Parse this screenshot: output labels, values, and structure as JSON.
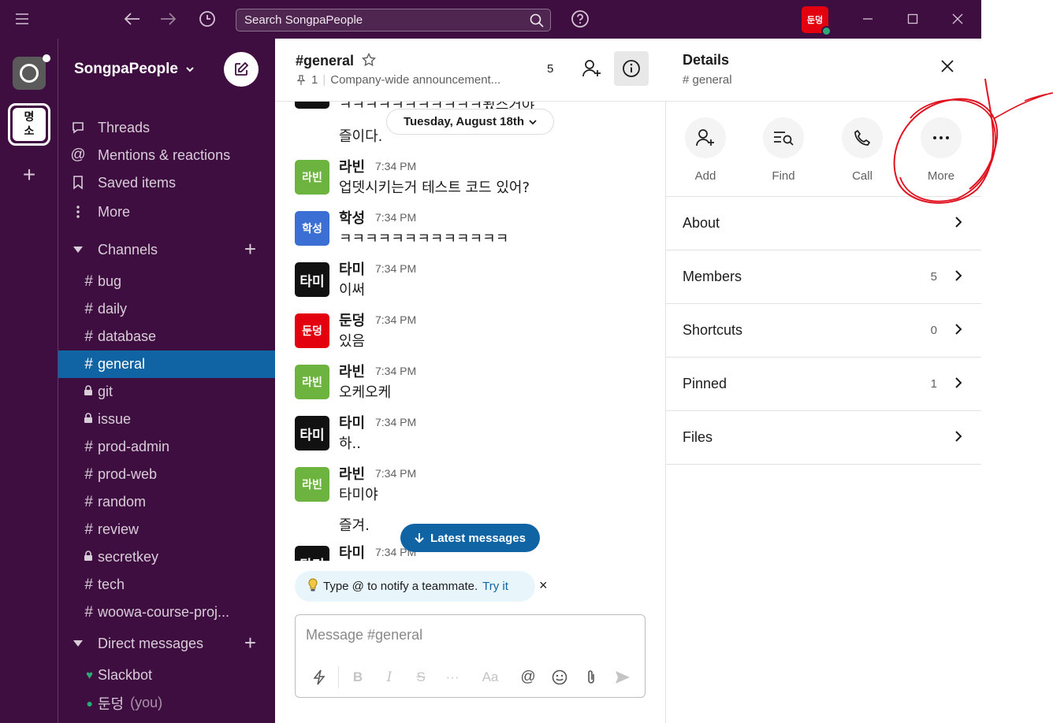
{
  "titlebar": {
    "search_placeholder": "Search SongpaPeople",
    "user_avatar_text": "둔덩"
  },
  "rail": {
    "workspace2_text_top": "명",
    "workspace2_text_bottom": "소"
  },
  "sidebar": {
    "workspace_name": "SongpaPeople",
    "nav": [
      {
        "label": "Threads"
      },
      {
        "label": "Mentions & reactions"
      },
      {
        "label": "Saved items"
      },
      {
        "label": "More"
      }
    ],
    "channels_header": "Channels",
    "channels": [
      {
        "prefix": "#",
        "name": "bug"
      },
      {
        "prefix": "#",
        "name": "daily"
      },
      {
        "prefix": "#",
        "name": "database"
      },
      {
        "prefix": "#",
        "name": "general"
      },
      {
        "prefix": "lock",
        "name": "git"
      },
      {
        "prefix": "lock",
        "name": "issue"
      },
      {
        "prefix": "#",
        "name": "prod-admin"
      },
      {
        "prefix": "#",
        "name": "prod-web"
      },
      {
        "prefix": "#",
        "name": "random"
      },
      {
        "prefix": "#",
        "name": "review"
      },
      {
        "prefix": "lock",
        "name": "secretkey"
      },
      {
        "prefix": "#",
        "name": "tech"
      },
      {
        "prefix": "#",
        "name": "woowa-course-proj..."
      }
    ],
    "dm_header": "Direct messages",
    "dms": [
      {
        "name": "Slackbot",
        "suffix": ""
      },
      {
        "name": "둔덩",
        "suffix": "(you)"
      }
    ]
  },
  "channel": {
    "title": "#general",
    "pinned_count": "1",
    "topic": "Company-wide announcement...",
    "member_count": "5",
    "date_divider": "Tuesday, August 18th",
    "top_partial_text": "ㅋㅋㅋㅋㅋㅋㅋㅋㅋㅋㅋ됬스거야",
    "first_cont": "즐이다.",
    "messages": [
      {
        "avatar": "라빈",
        "name": "라빈",
        "time": "7:34 PM",
        "text": "업뎃시키는거 테스트 코드 있어?"
      },
      {
        "avatar": "학성",
        "name": "학성",
        "time": "7:34 PM",
        "text": "ㅋㅋㅋㅋㅋㅋㅋㅋㅋㅋㅋㅋㅋ"
      },
      {
        "avatar": "타미",
        "name": "타미",
        "time": "7:34 PM",
        "text": "이써"
      },
      {
        "avatar": "둔덩",
        "name": "둔덩",
        "time": "7:34 PM",
        "text": "있음"
      },
      {
        "avatar": "라빈",
        "name": "라빈",
        "time": "7:34 PM",
        "text": "오케오케"
      },
      {
        "avatar": "타미",
        "name": "타미",
        "time": "7:34 PM",
        "text": "하.."
      },
      {
        "avatar": "라빈",
        "name": "라빈",
        "time": "7:34 PM",
        "text": "타미야"
      }
    ],
    "cont_after": "즐겨.",
    "last_msg": {
      "avatar": "타미",
      "name": "타미",
      "time": "7:34 PM"
    },
    "latest_label": "Latest messages",
    "tip_text": "Type @ to notify a teammate.",
    "tip_link": "Try it",
    "composer_placeholder": "Message #general"
  },
  "details": {
    "title": "Details",
    "subtitle": "# general",
    "actions": [
      {
        "label": "Add"
      },
      {
        "label": "Find"
      },
      {
        "label": "Call"
      },
      {
        "label": "More"
      }
    ],
    "rows": [
      {
        "label": "About",
        "count": ""
      },
      {
        "label": "Members",
        "count": "5"
      },
      {
        "label": "Shortcuts",
        "count": "0"
      },
      {
        "label": "Pinned",
        "count": "1"
      },
      {
        "label": "Files",
        "count": ""
      }
    ]
  },
  "colors": {
    "aubergine": "#3f0e40",
    "active_channel": "#1164a3",
    "avatar_rabin": "#6db33f",
    "avatar_haksung": "#3b6fd3",
    "avatar_tami": "#111111",
    "avatar_dundung": "#e3000f",
    "annotation": "#e0121f"
  }
}
